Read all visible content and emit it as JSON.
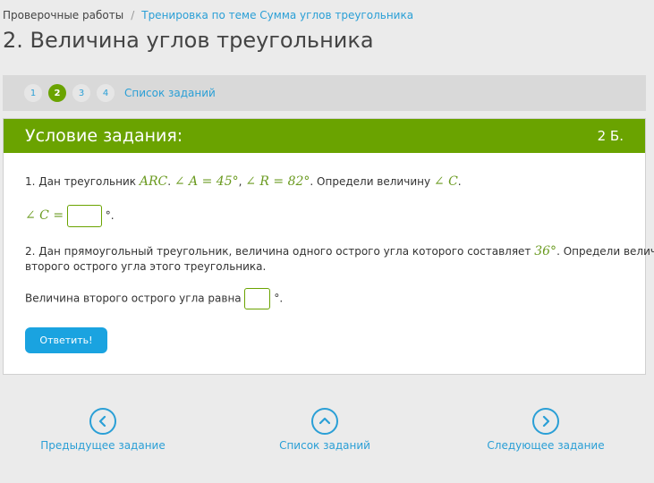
{
  "breadcrumb": {
    "root": "Проверочные работы",
    "separator": "/",
    "current": "Тренировка по теме Сумма углов треугольника"
  },
  "page_title": "2. Величина углов треугольника",
  "task_nav": {
    "numbers": [
      "1",
      "2",
      "3",
      "4"
    ],
    "active": "2",
    "list_link": "Список заданий"
  },
  "task": {
    "header_title": "Условие задания:",
    "points": "2 Б.",
    "q1": {
      "prefix": "1. Дан треугольник ",
      "triangle": "ARC",
      "angle_a": "∠ A = 45°",
      "angle_r": "∠ R = 82°",
      "middle": ". Определи величину ",
      "angle_c": "∠ C",
      "answer_label": "∠ C =",
      "answer_value": "",
      "degree_suffix": "°."
    },
    "q2": {
      "text_before": "2. Дан прямоугольный треугольник, величина одного острого угла которого составляет ",
      "angle": "36°",
      "text_after": ". Определи величину",
      "text_line2": "второго острого угла этого треугольника.",
      "answer_label": "Величина второго острого угла равна",
      "answer_value": "",
      "degree_suffix": "°."
    },
    "submit_label": "Ответить!"
  },
  "bottom_nav": {
    "prev_label": "Предыдущее задание",
    "list_label": "Список заданий",
    "next_label": "Следующее задание"
  },
  "colors": {
    "accent_green": "#6aa300",
    "link_blue": "#2a9fd6",
    "button_blue": "#1aa3e0"
  }
}
